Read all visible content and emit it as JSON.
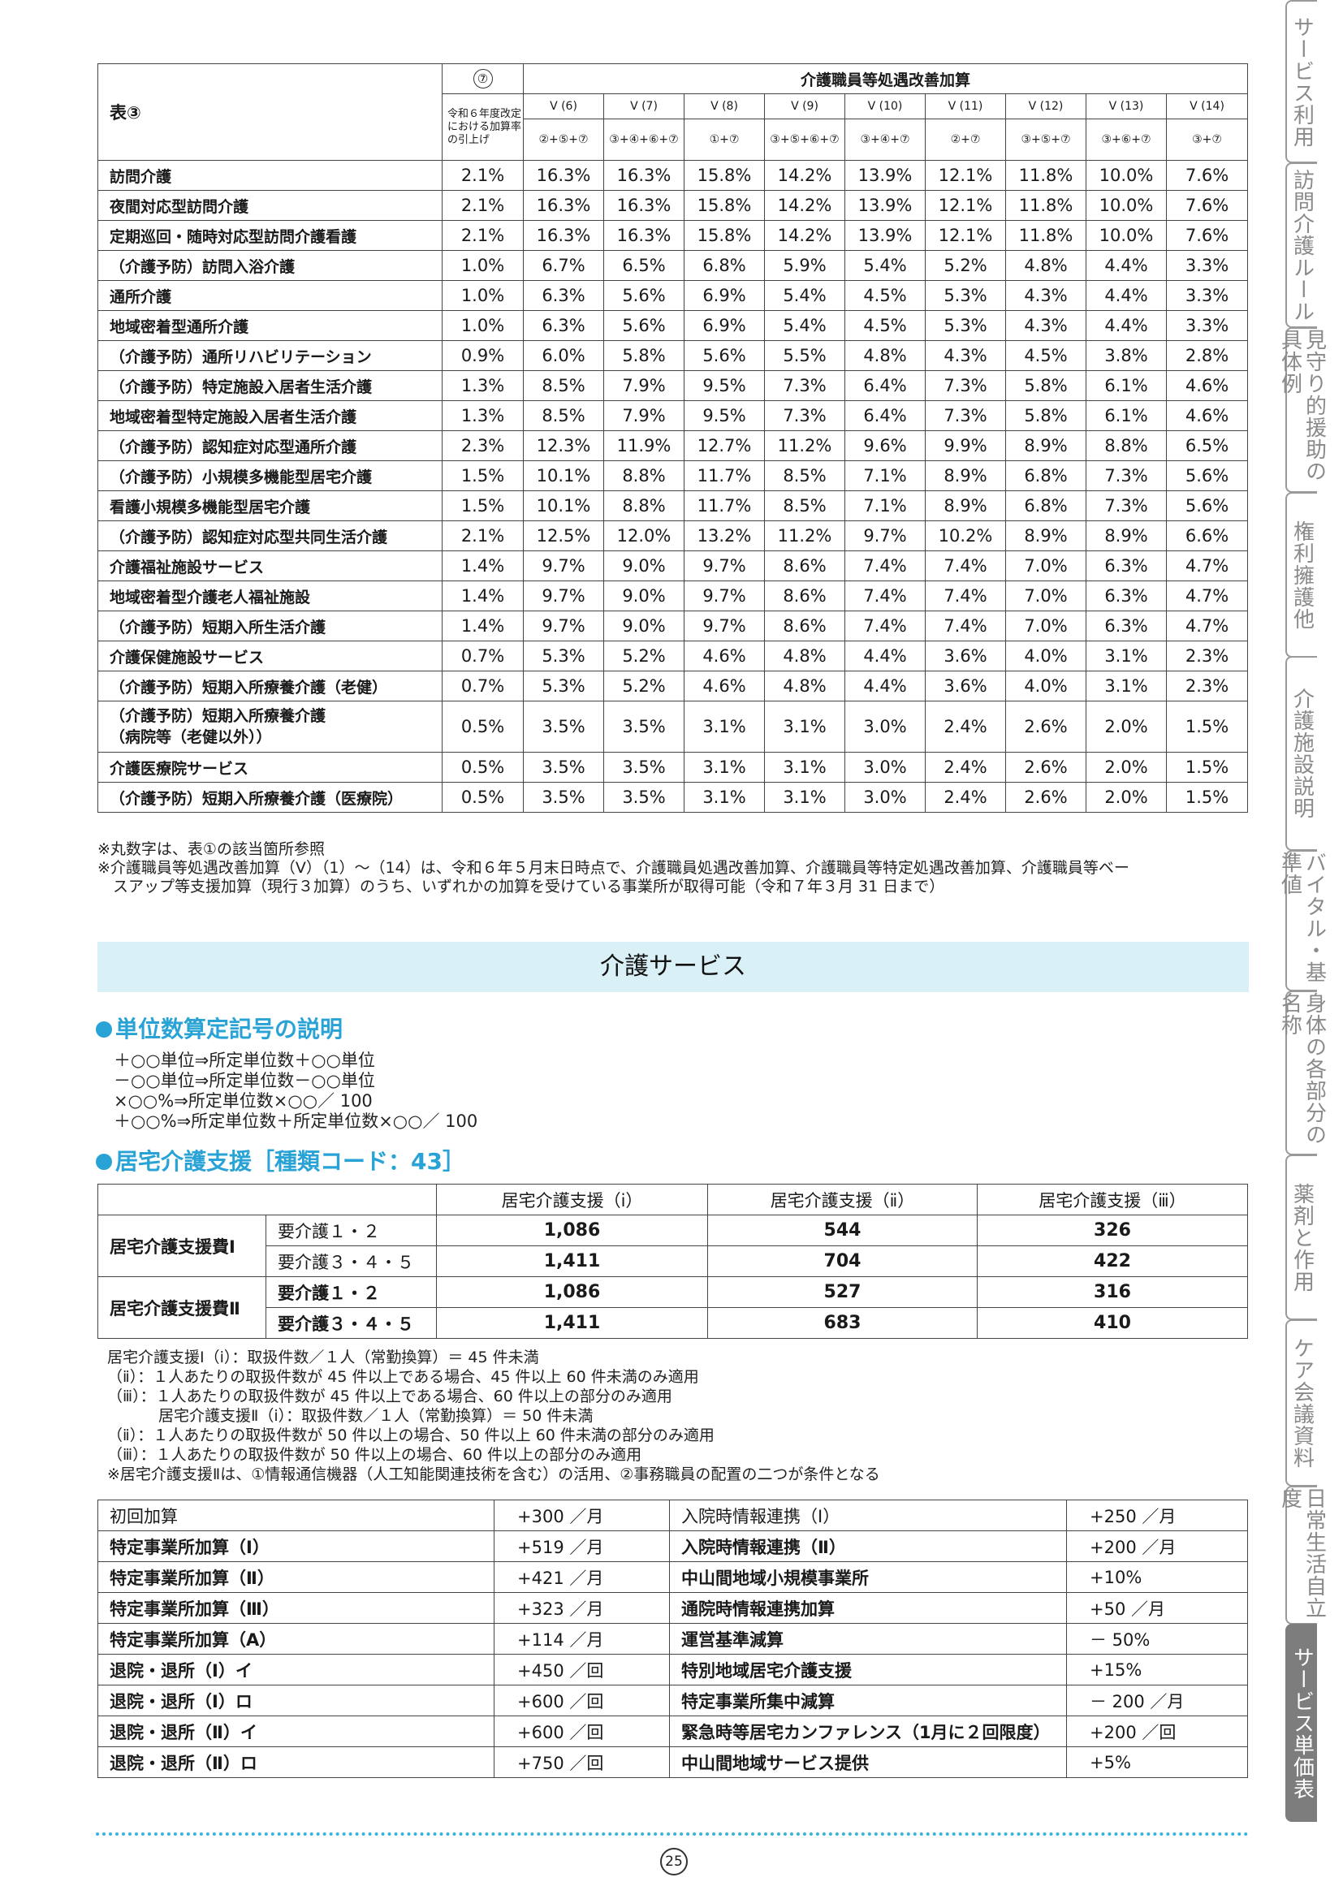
{
  "table3": {
    "corner_label": "表③",
    "col7_header": "⑦",
    "col7_desc": "令和６年度改定における加算率の引上げ",
    "group_title": "介護職員等処遇改善加算",
    "columns": [
      {
        "name": "Ⅴ (6)",
        "formula": "②+⑤+⑦"
      },
      {
        "name": "Ⅴ (7)",
        "formula": "③+④+⑥+⑦"
      },
      {
        "name": "Ⅴ (8)",
        "formula": "①+⑦"
      },
      {
        "name": "Ⅴ (9)",
        "formula": "③+⑤+⑥+⑦"
      },
      {
        "name": "Ⅴ (10)",
        "formula": "③+④+⑦"
      },
      {
        "name": "Ⅴ (11)",
        "formula": "②+⑦"
      },
      {
        "name": "Ⅴ (12)",
        "formula": "③+⑤+⑦"
      },
      {
        "name": "Ⅴ (13)",
        "formula": "③+⑥+⑦"
      },
      {
        "name": "Ⅴ (14)",
        "formula": "③+⑦"
      }
    ],
    "rows": [
      {
        "label": "訪問介護",
        "values": [
          "2.1%",
          "16.3%",
          "16.3%",
          "15.8%",
          "14.2%",
          "13.9%",
          "12.1%",
          "11.8%",
          "10.0%",
          "7.6%"
        ]
      },
      {
        "label": "夜間対応型訪問介護",
        "values": [
          "2.1%",
          "16.3%",
          "16.3%",
          "15.8%",
          "14.2%",
          "13.9%",
          "12.1%",
          "11.8%",
          "10.0%",
          "7.6%"
        ]
      },
      {
        "label": "定期巡回・随時対応型訪問介護看護",
        "values": [
          "2.1%",
          "16.3%",
          "16.3%",
          "15.8%",
          "14.2%",
          "13.9%",
          "12.1%",
          "11.8%",
          "10.0%",
          "7.6%"
        ]
      },
      {
        "label": "（介護予防）訪問入浴介護",
        "values": [
          "1.0%",
          "6.7%",
          "6.5%",
          "6.8%",
          "5.9%",
          "5.4%",
          "5.2%",
          "4.8%",
          "4.4%",
          "3.3%"
        ]
      },
      {
        "label": "通所介護",
        "values": [
          "1.0%",
          "6.3%",
          "5.6%",
          "6.9%",
          "5.4%",
          "4.5%",
          "5.3%",
          "4.3%",
          "4.4%",
          "3.3%"
        ]
      },
      {
        "label": "地域密着型通所介護",
        "values": [
          "1.0%",
          "6.3%",
          "5.6%",
          "6.9%",
          "5.4%",
          "4.5%",
          "5.3%",
          "4.3%",
          "4.4%",
          "3.3%"
        ]
      },
      {
        "label": "（介護予防）通所リハビリテーション",
        "values": [
          "0.9%",
          "6.0%",
          "5.8%",
          "5.6%",
          "5.5%",
          "4.8%",
          "4.3%",
          "4.5%",
          "3.8%",
          "2.8%"
        ]
      },
      {
        "label": "（介護予防）特定施設入居者生活介護",
        "values": [
          "1.3%",
          "8.5%",
          "7.9%",
          "9.5%",
          "7.3%",
          "6.4%",
          "7.3%",
          "5.8%",
          "6.1%",
          "4.6%"
        ]
      },
      {
        "label": "地域密着型特定施設入居者生活介護",
        "values": [
          "1.3%",
          "8.5%",
          "7.9%",
          "9.5%",
          "7.3%",
          "6.4%",
          "7.3%",
          "5.8%",
          "6.1%",
          "4.6%"
        ]
      },
      {
        "label": "（介護予防）認知症対応型通所介護",
        "values": [
          "2.3%",
          "12.3%",
          "11.9%",
          "12.7%",
          "11.2%",
          "9.6%",
          "9.9%",
          "8.9%",
          "8.8%",
          "6.5%"
        ]
      },
      {
        "label": "（介護予防）小規模多機能型居宅介護",
        "values": [
          "1.5%",
          "10.1%",
          "8.8%",
          "11.7%",
          "8.5%",
          "7.1%",
          "8.9%",
          "6.8%",
          "7.3%",
          "5.6%"
        ]
      },
      {
        "label": "看護小規模多機能型居宅介護",
        "values": [
          "1.5%",
          "10.1%",
          "8.8%",
          "11.7%",
          "8.5%",
          "7.1%",
          "8.9%",
          "6.8%",
          "7.3%",
          "5.6%"
        ]
      },
      {
        "label": "（介護予防）認知症対応型共同生活介護",
        "values": [
          "2.1%",
          "12.5%",
          "12.0%",
          "13.2%",
          "11.2%",
          "9.7%",
          "10.2%",
          "8.9%",
          "8.9%",
          "6.6%"
        ]
      },
      {
        "label": "介護福祉施設サービス",
        "values": [
          "1.4%",
          "9.7%",
          "9.0%",
          "9.7%",
          "8.6%",
          "7.4%",
          "7.4%",
          "7.0%",
          "6.3%",
          "4.7%"
        ]
      },
      {
        "label": "地域密着型介護老人福祉施設",
        "values": [
          "1.4%",
          "9.7%",
          "9.0%",
          "9.7%",
          "8.6%",
          "7.4%",
          "7.4%",
          "7.0%",
          "6.3%",
          "4.7%"
        ]
      },
      {
        "label": "（介護予防）短期入所生活介護",
        "values": [
          "1.4%",
          "9.7%",
          "9.0%",
          "9.7%",
          "8.6%",
          "7.4%",
          "7.4%",
          "7.0%",
          "6.3%",
          "4.7%"
        ]
      },
      {
        "label": "介護保健施設サービス",
        "values": [
          "0.7%",
          "5.3%",
          "5.2%",
          "4.6%",
          "4.8%",
          "4.4%",
          "3.6%",
          "4.0%",
          "3.1%",
          "2.3%"
        ]
      },
      {
        "label": "（介護予防）短期入所療養介護（老健）",
        "values": [
          "0.7%",
          "5.3%",
          "5.2%",
          "4.6%",
          "4.8%",
          "4.4%",
          "3.6%",
          "4.0%",
          "3.1%",
          "2.3%"
        ]
      },
      {
        "label": "（介護予防）短期入所療養介護\n（病院等（老健以外））",
        "values": [
          "0.5%",
          "3.5%",
          "3.5%",
          "3.1%",
          "3.1%",
          "3.0%",
          "2.4%",
          "2.6%",
          "2.0%",
          "1.5%"
        ]
      },
      {
        "label": "介護医療院サービス",
        "values": [
          "0.5%",
          "3.5%",
          "3.5%",
          "3.1%",
          "3.1%",
          "3.0%",
          "2.4%",
          "2.6%",
          "2.0%",
          "1.5%"
        ]
      },
      {
        "label": "（介護予防）短期入所療養介護（医療院）",
        "values": [
          "0.5%",
          "3.5%",
          "3.5%",
          "3.1%",
          "3.1%",
          "3.0%",
          "2.4%",
          "2.6%",
          "2.0%",
          "1.5%"
        ]
      }
    ],
    "notes": [
      "※丸数字は、表①の該当箇所参照",
      "※介護職員等処遇改善加算（Ⅴ）（1）～（14）は、令和６年５月末日時点で、介護職員処遇改善加算、介護職員等特定処遇改善加算、介護職員等ベー",
      "　スアップ等支援加算（現行３加算）のうち、いずれかの加算を受けている事業所が取得可能（令和７年３月 31 日まで）"
    ]
  },
  "section_title": "介護サービス",
  "unit_explain": {
    "heading": "単位数算定記号の説明",
    "lines": [
      "＋○○単位⇒所定単位数＋○○単位",
      "－○○単位⇒所定単位数－○○単位",
      "×○○%⇒所定単位数×○○／ 100",
      "＋○○%⇒所定単位数＋所定単位数×○○／ 100"
    ]
  },
  "care_support": {
    "heading": "居宅介護支援［種類コード：43］",
    "col_headers": [
      "居宅介護支援（ⅰ）",
      "居宅介護支援（ⅱ）",
      "居宅介護支援（ⅲ）"
    ],
    "groups": [
      {
        "name": "居宅介護支援費Ⅰ",
        "rows": [
          {
            "level": "要介護１・２",
            "values": [
              "1,086",
              "544",
              "326"
            ]
          },
          {
            "level": "要介護３・４・５",
            "values": [
              "1,411",
              "704",
              "422"
            ]
          }
        ]
      },
      {
        "name": "居宅介護支援費Ⅱ",
        "rows": [
          {
            "level": "要介護１・２",
            "values": [
              "1,086",
              "527",
              "316"
            ]
          },
          {
            "level": "要介護３・４・５",
            "values": [
              "1,411",
              "683",
              "410"
            ]
          }
        ]
      }
    ],
    "notes": [
      "居宅介護支援Ⅰ（ⅰ）：取扱件数／１人（常勤換算）＝ 45 件未満",
      "（ⅱ）：１人あたりの取扱件数が 45 件以上である場合、45 件以上 60 件未満のみ適用",
      "（ⅲ）：１人あたりの取扱件数が 45 件以上である場合、60 件以上の部分のみ適用",
      "　　　 居宅介護支援Ⅱ（ⅰ）：取扱件数／１人（常勤換算）＝ 50 件未満",
      "（ⅱ）：１人あたりの取扱件数が 50 件以上の場合、50 件以上 60 件未満の部分のみ適用",
      "（ⅲ）：１人あたりの取扱件数が 50 件以上の場合、60 件以上の部分のみ適用",
      "※居宅介護支援Ⅱは、①情報通信機器（人工知能関連技術を含む）の活用、②事務職員の配置の二つが条件となる"
    ]
  },
  "additions": [
    {
      "left_name": "初回加算",
      "left_value": "+300 ／月",
      "right_name": "入院時情報連携（Ⅰ）",
      "right_value": "+250 ／月"
    },
    {
      "left_name": "特定事業所加算（Ⅰ）",
      "left_value": "+519 ／月",
      "right_name": "入院時情報連携（Ⅱ）",
      "right_value": "+200 ／月"
    },
    {
      "left_name": "特定事業所加算（Ⅱ）",
      "left_value": "+421 ／月",
      "right_name": "中山間地域小規模事業所",
      "right_value": "+10%"
    },
    {
      "left_name": "特定事業所加算（Ⅲ）",
      "left_value": "+323 ／月",
      "right_name": "通院時情報連携加算",
      "right_value": "+50 ／月"
    },
    {
      "left_name": "特定事業所加算（A）",
      "left_value": "+114 ／月",
      "right_name": "運営基準減算",
      "right_value": "－ 50%"
    },
    {
      "left_name": "退院・退所（Ⅰ）イ",
      "left_value": "+450 ／回",
      "right_name": "特別地域居宅介護支援",
      "right_value": "+15%"
    },
    {
      "left_name": "退院・退所（Ⅰ）ロ",
      "left_value": "+600 ／回",
      "right_name": "特定事業所集中減算",
      "right_value": "－ 200 ／月"
    },
    {
      "left_name": "退院・退所（Ⅱ）イ",
      "left_value": "+600 ／回",
      "right_name": "緊急時等居宅カンファレンス（1月に２回限度）",
      "right_value": "+200 ／回"
    },
    {
      "left_name": "退院・退所（Ⅱ）ロ",
      "left_value": "+750 ／回",
      "right_name": "中山間地域サービス提供",
      "right_value": "+5%"
    }
  ],
  "side_tabs": [
    "サービス利用",
    "訪問介護ルール",
    "見守り的援助の具体例",
    "権利擁護他",
    "介護施設説明",
    "バイタル・基準値",
    "身体の各部分の名称",
    "薬剤と作用",
    "ケア会議資料",
    "日常生活自立度",
    "サービス単価表"
  ],
  "page_number": "25"
}
